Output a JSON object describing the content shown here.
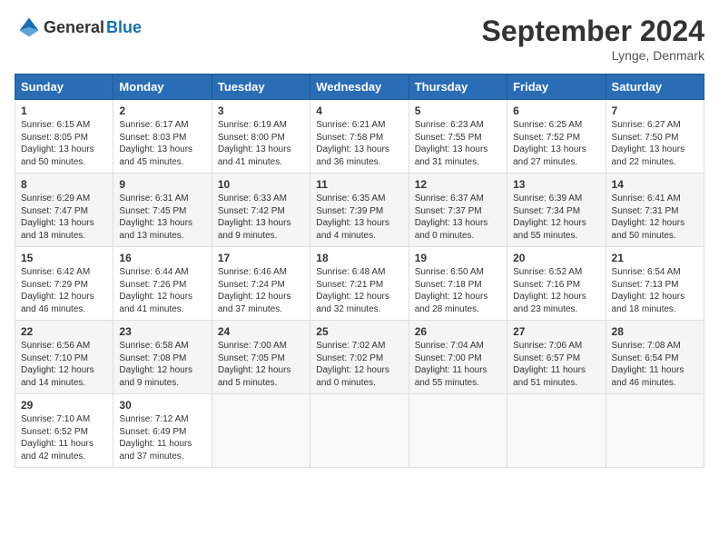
{
  "header": {
    "logo_general": "General",
    "logo_blue": "Blue",
    "title": "September 2024",
    "location": "Lynge, Denmark"
  },
  "days_of_week": [
    "Sunday",
    "Monday",
    "Tuesday",
    "Wednesday",
    "Thursday",
    "Friday",
    "Saturday"
  ],
  "weeks": [
    [
      {
        "day": 1,
        "sunrise": "6:15 AM",
        "sunset": "8:05 PM",
        "daylight": "13 hours and 50 minutes."
      },
      {
        "day": 2,
        "sunrise": "6:17 AM",
        "sunset": "8:03 PM",
        "daylight": "13 hours and 45 minutes."
      },
      {
        "day": 3,
        "sunrise": "6:19 AM",
        "sunset": "8:00 PM",
        "daylight": "13 hours and 41 minutes."
      },
      {
        "day": 4,
        "sunrise": "6:21 AM",
        "sunset": "7:58 PM",
        "daylight": "13 hours and 36 minutes."
      },
      {
        "day": 5,
        "sunrise": "6:23 AM",
        "sunset": "7:55 PM",
        "daylight": "13 hours and 31 minutes."
      },
      {
        "day": 6,
        "sunrise": "6:25 AM",
        "sunset": "7:52 PM",
        "daylight": "13 hours and 27 minutes."
      },
      {
        "day": 7,
        "sunrise": "6:27 AM",
        "sunset": "7:50 PM",
        "daylight": "13 hours and 22 minutes."
      }
    ],
    [
      {
        "day": 8,
        "sunrise": "6:29 AM",
        "sunset": "7:47 PM",
        "daylight": "13 hours and 18 minutes."
      },
      {
        "day": 9,
        "sunrise": "6:31 AM",
        "sunset": "7:45 PM",
        "daylight": "13 hours and 13 minutes."
      },
      {
        "day": 10,
        "sunrise": "6:33 AM",
        "sunset": "7:42 PM",
        "daylight": "13 hours and 9 minutes."
      },
      {
        "day": 11,
        "sunrise": "6:35 AM",
        "sunset": "7:39 PM",
        "daylight": "13 hours and 4 minutes."
      },
      {
        "day": 12,
        "sunrise": "6:37 AM",
        "sunset": "7:37 PM",
        "daylight": "13 hours and 0 minutes."
      },
      {
        "day": 13,
        "sunrise": "6:39 AM",
        "sunset": "7:34 PM",
        "daylight": "12 hours and 55 minutes."
      },
      {
        "day": 14,
        "sunrise": "6:41 AM",
        "sunset": "7:31 PM",
        "daylight": "12 hours and 50 minutes."
      }
    ],
    [
      {
        "day": 15,
        "sunrise": "6:42 AM",
        "sunset": "7:29 PM",
        "daylight": "12 hours and 46 minutes."
      },
      {
        "day": 16,
        "sunrise": "6:44 AM",
        "sunset": "7:26 PM",
        "daylight": "12 hours and 41 minutes."
      },
      {
        "day": 17,
        "sunrise": "6:46 AM",
        "sunset": "7:24 PM",
        "daylight": "12 hours and 37 minutes."
      },
      {
        "day": 18,
        "sunrise": "6:48 AM",
        "sunset": "7:21 PM",
        "daylight": "12 hours and 32 minutes."
      },
      {
        "day": 19,
        "sunrise": "6:50 AM",
        "sunset": "7:18 PM",
        "daylight": "12 hours and 28 minutes."
      },
      {
        "day": 20,
        "sunrise": "6:52 AM",
        "sunset": "7:16 PM",
        "daylight": "12 hours and 23 minutes."
      },
      {
        "day": 21,
        "sunrise": "6:54 AM",
        "sunset": "7:13 PM",
        "daylight": "12 hours and 18 minutes."
      }
    ],
    [
      {
        "day": 22,
        "sunrise": "6:56 AM",
        "sunset": "7:10 PM",
        "daylight": "12 hours and 14 minutes."
      },
      {
        "day": 23,
        "sunrise": "6:58 AM",
        "sunset": "7:08 PM",
        "daylight": "12 hours and 9 minutes."
      },
      {
        "day": 24,
        "sunrise": "7:00 AM",
        "sunset": "7:05 PM",
        "daylight": "12 hours and 5 minutes."
      },
      {
        "day": 25,
        "sunrise": "7:02 AM",
        "sunset": "7:02 PM",
        "daylight": "12 hours and 0 minutes."
      },
      {
        "day": 26,
        "sunrise": "7:04 AM",
        "sunset": "7:00 PM",
        "daylight": "11 hours and 55 minutes."
      },
      {
        "day": 27,
        "sunrise": "7:06 AM",
        "sunset": "6:57 PM",
        "daylight": "11 hours and 51 minutes."
      },
      {
        "day": 28,
        "sunrise": "7:08 AM",
        "sunset": "6:54 PM",
        "daylight": "11 hours and 46 minutes."
      }
    ],
    [
      {
        "day": 29,
        "sunrise": "7:10 AM",
        "sunset": "6:52 PM",
        "daylight": "11 hours and 42 minutes."
      },
      {
        "day": 30,
        "sunrise": "7:12 AM",
        "sunset": "6:49 PM",
        "daylight": "11 hours and 37 minutes."
      },
      null,
      null,
      null,
      null,
      null
    ]
  ]
}
